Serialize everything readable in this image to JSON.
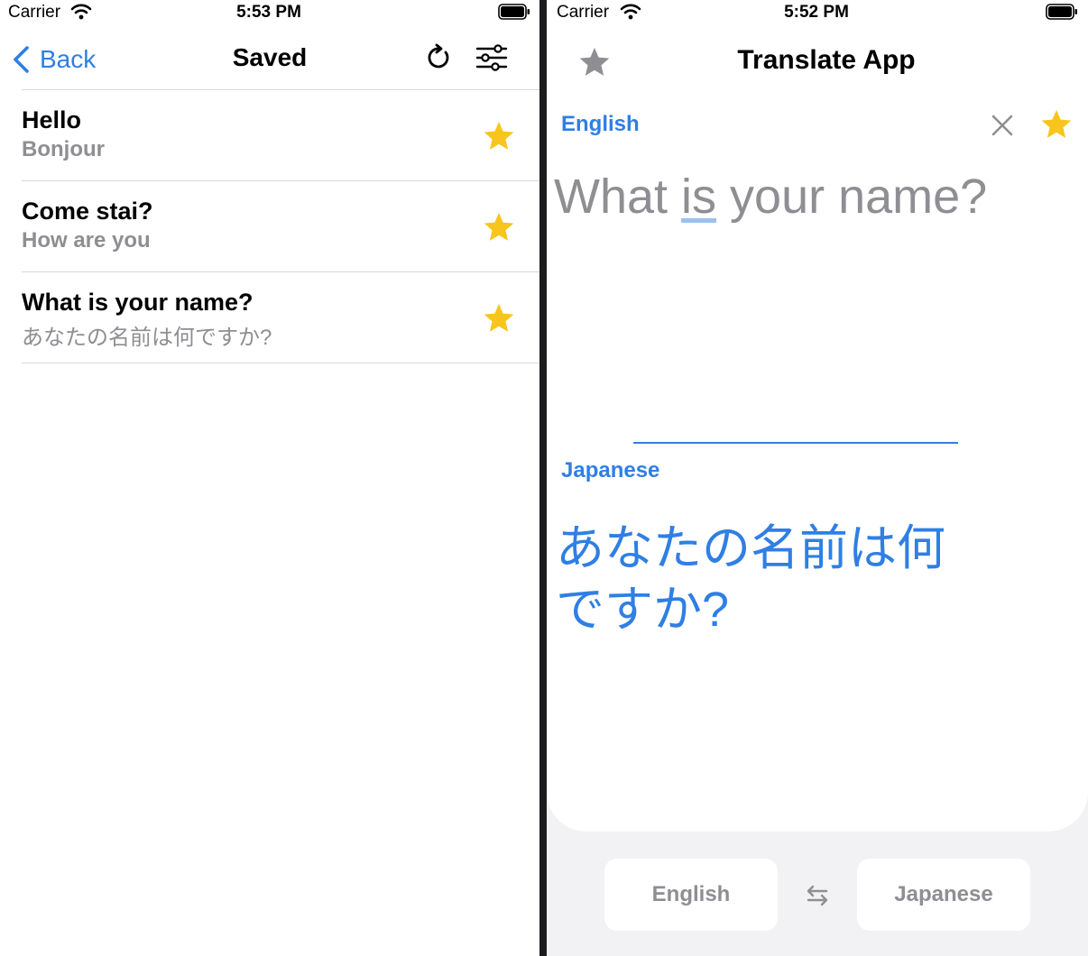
{
  "left": {
    "status": {
      "carrier": "Carrier",
      "time": "5:53 PM"
    },
    "nav": {
      "back_label": "Back",
      "title": "Saved"
    },
    "items": [
      {
        "primary": "Hello",
        "secondary": "Bonjour",
        "starred": true
      },
      {
        "primary": "Come stai?",
        "secondary": "How are you",
        "starred": true
      },
      {
        "primary": "What is your name?",
        "secondary": "あなたの名前は何ですか?",
        "starred": true
      }
    ]
  },
  "right": {
    "status": {
      "carrier": "Carrier",
      "time": "5:52 PM"
    },
    "title": "Translate App",
    "source_label": "English",
    "source_text_before": "What ",
    "source_text_underlined": "is",
    "source_text_after": " your name?",
    "target_label": "Japanese",
    "target_text": "あなたの名前は何ですか?",
    "bottom": {
      "from_language": "English",
      "to_language": "Japanese"
    }
  },
  "colors": {
    "accent": "#2f7fe4",
    "star": "#f7c51c",
    "secondary_text": "#8e8e93",
    "inactive_star": "#8e8e93"
  },
  "icons": {
    "back": "chevron-left-icon",
    "refresh": "refresh-icon",
    "filter": "sliders-icon",
    "star": "star-icon",
    "clear": "close-icon",
    "swap": "swap-arrows-icon"
  }
}
